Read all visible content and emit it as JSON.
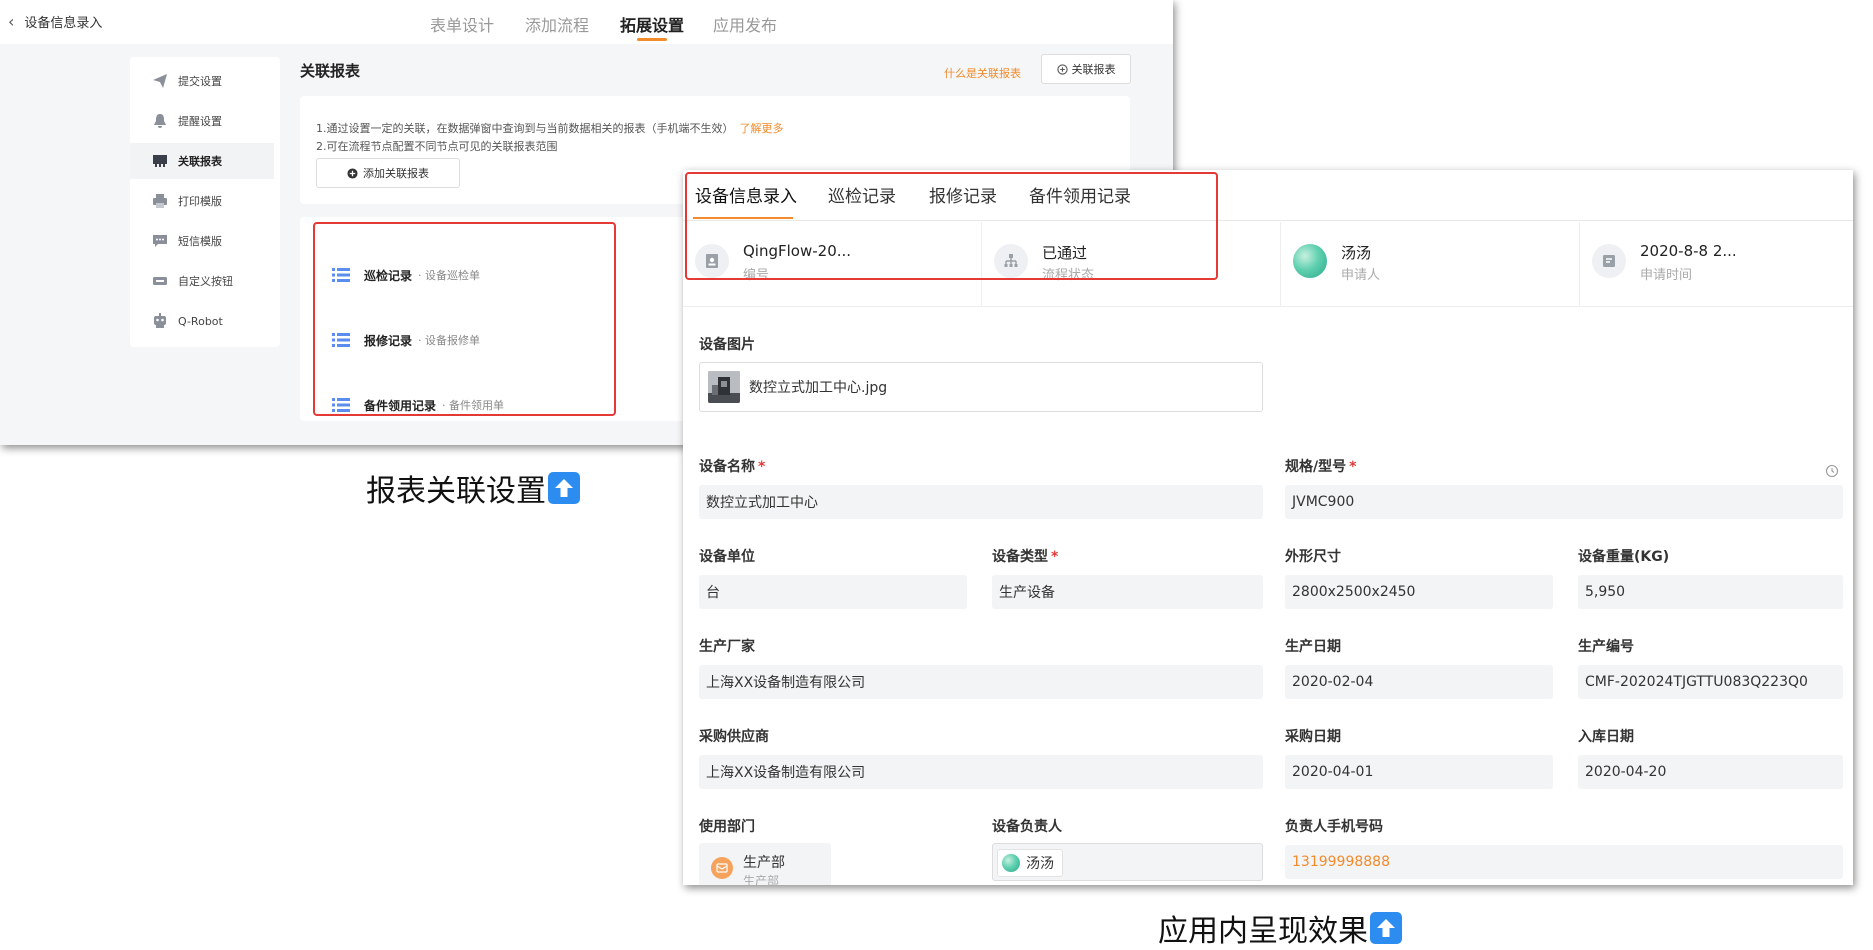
{
  "settings": {
    "back_label": "设备信息录入",
    "tabs": [
      "表单设计",
      "添加流程",
      "拓展设置",
      "应用发布"
    ],
    "active_tab": "拓展设置",
    "menu": [
      "提交设置",
      "提醒设置",
      "关联报表",
      "打印模版",
      "短信模版",
      "自定义按钮",
      "Q-Robot"
    ],
    "active_menu": "关联报表",
    "section_title": "关联报表",
    "what_link": "什么是关联报表",
    "link_button": "关联报表",
    "notes": [
      "1.通过设置一定的关联，在数据弹窗中查询到与当前数据相关的报表（手机端不生效）",
      "2.可在流程节点配置不同节点可见的关联报表范围"
    ],
    "learn_more": "了解更多",
    "add_button": "添加关联报表",
    "reports": [
      {
        "name": "巡检记录",
        "source": "· 设备巡检单"
      },
      {
        "name": "报修记录",
        "source": "· 设备报修单"
      },
      {
        "name": "备件领用记录",
        "source": "· 备件领用单"
      }
    ]
  },
  "captions": {
    "left": "报表关联设置",
    "right": "应用内呈现效果"
  },
  "app": {
    "tabs": [
      "设备信息录入",
      "巡检记录",
      "报修记录",
      "备件领用记录"
    ],
    "active_tab": "设备信息录入",
    "summary": [
      {
        "value": "QingFlow-20...",
        "label": "编号",
        "icon": "id-icon"
      },
      {
        "value": "已通过",
        "label": "流程状态",
        "icon": "flow-icon"
      },
      {
        "value": "汤汤",
        "label": "申请人",
        "icon": "avatar"
      },
      {
        "value": "2020-8-8 2...",
        "label": "申请时间",
        "icon": "time-icon"
      }
    ],
    "image_field": {
      "label": "设备图片",
      "file": "数控立式加工中心.jpg"
    },
    "fields": {
      "name": {
        "label": "设备名称",
        "value": "数控立式加工中心"
      },
      "model": {
        "label": "规格/型号",
        "value": "JVMC900"
      },
      "unit": {
        "label": "设备单位",
        "value": "台"
      },
      "type": {
        "label": "设备类型",
        "value": "生产设备"
      },
      "size": {
        "label": "外形尺寸",
        "value": "2800x2500x2450"
      },
      "weight": {
        "label": "设备重量(KG)",
        "value": "5,950"
      },
      "maker": {
        "label": "生产厂家",
        "value": "上海XX设备制造有限公司"
      },
      "mdate": {
        "label": "生产日期",
        "value": "2020-02-04"
      },
      "mno": {
        "label": "生产编号",
        "value": "CMF-202024TJGTTU083Q223Q0"
      },
      "supplier": {
        "label": "采购供应商",
        "value": "上海XX设备制造有限公司"
      },
      "pdate": {
        "label": "采购日期",
        "value": "2020-04-01"
      },
      "indate": {
        "label": "入库日期",
        "value": "2020-04-20"
      },
      "dept": {
        "label": "使用部门",
        "value": "生产部",
        "sub": "生产部"
      },
      "owner": {
        "label": "设备负责人",
        "value": "汤汤"
      },
      "phone": {
        "label": "负责人手机号码",
        "value": "13199998888"
      }
    }
  },
  "colors": {
    "accent": "#f28b2b",
    "highlight": "#e53935",
    "up_icon": "#2d8cf0"
  }
}
